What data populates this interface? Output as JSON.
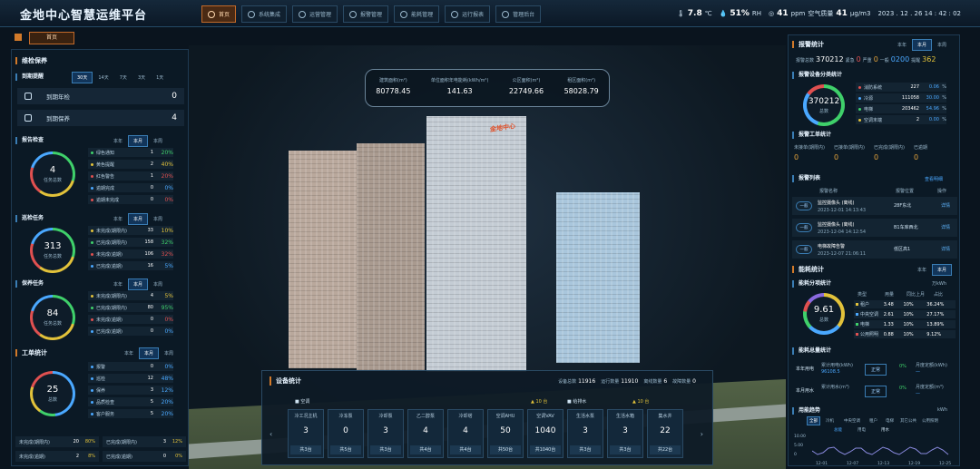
{
  "app": {
    "title": "金地中心智慧运维平台"
  },
  "nav": [
    {
      "label": "首页",
      "active": true
    },
    {
      "label": "系统集成"
    },
    {
      "label": "运营管理"
    },
    {
      "label": "报警管理"
    },
    {
      "label": "能耗管理"
    },
    {
      "label": "运行报表"
    },
    {
      "label": "管理后台"
    }
  ],
  "status": {
    "temp": "7.8",
    "temp_unit": "℃",
    "humidity": "51%",
    "humidity_unit": "RH",
    "co2": "41",
    "co2_unit": "ppm",
    "aq_label": "空气质量",
    "aq": "41",
    "aq_unit": "μg/m3",
    "datetime": "2023 . 12 . 26  14 : 42 : 02"
  },
  "home_tab": "首页",
  "scene": {
    "roof_sign": "金地中心",
    "stats": [
      {
        "label": "建筑面积(m²)",
        "value": "80778.45"
      },
      {
        "label": "单位面积年电能耗(kWh/m²)",
        "value": "141.63"
      },
      {
        "label": "公区面积(m²)",
        "value": "22749.66"
      },
      {
        "label": "租区面积(m²)",
        "value": "58028.79"
      }
    ]
  },
  "left": {
    "maint_title": "维检保养",
    "due_title": "到期提醒",
    "due_tabs": [
      "30天",
      "14天",
      "7天",
      "3天",
      "1天"
    ],
    "annual_label": "到期年检",
    "annual_value": "0",
    "service_label": "到期保养",
    "service_value": "4",
    "period_tabs": [
      "本年",
      "本月",
      "本周"
    ],
    "inspect": {
      "title": "报告检查",
      "total": "4",
      "total_label": "任务总数",
      "rows": [
        {
          "t": "绿色通知",
          "c": "1",
          "p": "20%",
          "col": "#3fd06a"
        },
        {
          "t": "黄色提醒",
          "c": "2",
          "p": "40%",
          "col": "#e2c23a"
        },
        {
          "t": "红色警告",
          "c": "1",
          "p": "20%",
          "col": "#e05050"
        },
        {
          "t": "逾期完成",
          "c": "0",
          "p": "0%",
          "col": "#4aa8ff"
        },
        {
          "t": "逾期未完成",
          "c": "0",
          "p": "0%",
          "col": "#e05050"
        }
      ]
    },
    "patrol": {
      "title": "巡检任务",
      "total": "313",
      "total_label": "任务总数",
      "rows": [
        {
          "t": "未完成(期限内)",
          "c": "33",
          "p": "10%",
          "col": "#e2c23a"
        },
        {
          "t": "已完成(期限内)",
          "c": "158",
          "p": "32%",
          "col": "#3fd06a"
        },
        {
          "t": "未完成(逾期)",
          "c": "106",
          "p": "32%",
          "col": "#e05050"
        },
        {
          "t": "已完成(逾期)",
          "c": "16",
          "p": "5%",
          "col": "#4aa8ff"
        }
      ]
    },
    "upkeep": {
      "title": "保养任务",
      "total": "84",
      "total_label": "任务总数",
      "rows": [
        {
          "t": "未完成(期限内)",
          "c": "4",
          "p": "5%",
          "col": "#e2c23a"
        },
        {
          "t": "已完成(期限内)",
          "c": "80",
          "p": "95%",
          "col": "#3fd06a"
        },
        {
          "t": "未完成(逾期)",
          "c": "0",
          "p": "0%",
          "col": "#e05050"
        },
        {
          "t": "已完成(逾期)",
          "c": "0",
          "p": "0%",
          "col": "#4aa8ff"
        }
      ]
    },
    "work": {
      "title": "工单统计",
      "total": "25",
      "total_label": "总数",
      "rows": [
        {
          "t": "报警",
          "c": "0",
          "p": "0%"
        },
        {
          "t": "巡检",
          "c": "12",
          "p": "48%"
        },
        {
          "t": "保养",
          "c": "3",
          "p": "12%"
        },
        {
          "t": "品质检查",
          "c": "5",
          "p": "20%"
        },
        {
          "t": "客户服务",
          "c": "5",
          "p": "20%"
        }
      ],
      "foot1": [
        {
          "t": "未完成(期限内)",
          "c": "20",
          "p": "80%"
        },
        {
          "t": "已完成(期限内)",
          "c": "3",
          "p": "12%"
        }
      ],
      "foot2": [
        {
          "t": "未完成(逾期)",
          "c": "2",
          "p": "8%"
        },
        {
          "t": "已完成(逾期)",
          "c": "0",
          "p": "0%"
        }
      ]
    }
  },
  "right": {
    "alarm_title": "报警统计",
    "tabs": [
      "本年",
      "本月",
      "本周"
    ],
    "alarm_total_label": "报警总数",
    "alarm_total": "370212",
    "urgent_label": "紧急",
    "urgent": "0",
    "serious_label": "严重",
    "serious": "0",
    "normal_label": "一般",
    "normal": "0200",
    "hint_label": "提醒",
    "hint": "362",
    "cat_title": "报警设备分类统计",
    "ring_total": "370212",
    "ring_label": "总数",
    "cats": [
      {
        "t": "消防系统",
        "c": "227",
        "p": "0.06",
        "col": "#e05050"
      },
      {
        "t": "冷源",
        "c": "111058",
        "p": "30.00",
        "col": "#4aa8ff"
      },
      {
        "t": "电梯",
        "c": "203462",
        "p": "54.96",
        "col": "#3fd06a"
      },
      {
        "t": "空调末端",
        "c": "2",
        "p": "0.00",
        "col": "#e2c23a"
      }
    ],
    "pct_unit": "%",
    "work_title": "报警工单统计",
    "work_heads": [
      "未接单(期限内)",
      "已接单(期限内)",
      "已完成(期限内)",
      "已逾期"
    ],
    "work_vals": [
      "0",
      "0",
      "0",
      "0"
    ],
    "list_title": "报警列表",
    "more_label": "查看明细",
    "list_heads": [
      "报警名称",
      "报警位置",
      "操作"
    ],
    "list": [
      {
        "level": "一般",
        "name": "监控摄像头 (离线)",
        "time": "2023-12-01 14:13:43",
        "loc": "28F东北",
        "op": "详情"
      },
      {
        "level": "一般",
        "name": "监控摄像头 (离线)",
        "time": "2023-12-04 14:12:54",
        "loc": "B1车库西北",
        "op": "详情"
      },
      {
        "level": "一般",
        "name": "电梯故障告警",
        "time": "2023-12-07 21:06:11",
        "loc": "低区高1",
        "op": "详情"
      }
    ],
    "energy_title": "能耗统计",
    "energy_tabs": [
      "本年",
      "本月"
    ],
    "energy_sub": "能耗分项统计",
    "energy_unit": "万kWh",
    "energy_total": "9.61",
    "energy_total_label": "总数",
    "energy_heads": [
      "类型",
      "用量",
      "同比上月",
      "占比"
    ],
    "energy_rows": [
      {
        "t": "租户",
        "u": "3.48",
        "y": "10%",
        "p": "36.24%",
        "col": "#e2c23a"
      },
      {
        "t": "中央空调",
        "u": "2.61",
        "y": "10%",
        "p": "27.17%",
        "col": "#4aa8ff"
      },
      {
        "t": "电梯",
        "u": "1.33",
        "y": "10%",
        "p": "13.89%",
        "col": "#3fd06a"
      },
      {
        "t": "公用照明",
        "u": "0.88",
        "y": "10%",
        "p": "9.12%",
        "col": "#e05050"
      }
    ],
    "quota_title": "能耗总量统计",
    "quota_rows": [
      {
        "period": "本年用电",
        "cum_label": "累计用电(kWh)",
        "cum": "96108.5",
        "status": "正常",
        "pct": "0%",
        "plan_label": "月度定额(kWh)",
        "plan": "—"
      },
      {
        "period": "本月用水",
        "cum_label": "累计用水(m³)",
        "cum": "",
        "status": "正常",
        "pct": "0%",
        "plan_label": "月度定额(m³)",
        "plan": "—"
      }
    ],
    "trend_title": "用能趋势",
    "trend_unit": "kWh",
    "trend_tabs": [
      "全部",
      "冷机",
      "中央空调",
      "租户",
      "电梯",
      "其它公共",
      "公用照明"
    ],
    "trend_legend": [
      "总能",
      "用电",
      "用水"
    ],
    "trend_xlabels": [
      "12-01",
      "12-07",
      "12-13",
      "12-19",
      "12-25"
    ],
    "trend_ylabels": [
      "10.00",
      "5.00",
      "0"
    ]
  },
  "equip": {
    "title": "设备统计",
    "summary": [
      {
        "label": "设备总数",
        "value": "11916"
      },
      {
        "label": "运行数量",
        "value": "11910"
      },
      {
        "label": "离线数量",
        "value": "6"
      },
      {
        "label": "故障数量",
        "value": "0"
      }
    ],
    "groups": [
      {
        "name": "空调"
      },
      {
        "name": "给排水"
      }
    ],
    "alarm_badges": [
      {
        "count": "10",
        "unit": "台"
      },
      {
        "count": "10",
        "unit": "台"
      }
    ],
    "cards": [
      {
        "name": "冷工况主机",
        "val": "3",
        "tot": "共3台"
      },
      {
        "name": "冷冻泵",
        "val": "0",
        "tot": "共5台"
      },
      {
        "name": "冷却泵",
        "val": "3",
        "tot": "共3台"
      },
      {
        "name": "乙二醇泵",
        "val": "4",
        "tot": "共4台"
      },
      {
        "name": "冷却塔",
        "val": "4",
        "tot": "共4台"
      },
      {
        "name": "空调AHU",
        "val": "50",
        "tot": "共50台"
      },
      {
        "name": "空调VAV",
        "val": "1040",
        "tot": "共1040台"
      },
      {
        "name": "生活水泵",
        "val": "3",
        "tot": "共3台"
      },
      {
        "name": "生活水箱",
        "val": "3",
        "tot": "共3台"
      },
      {
        "name": "集水井",
        "val": "22",
        "tot": "共22台"
      }
    ]
  }
}
